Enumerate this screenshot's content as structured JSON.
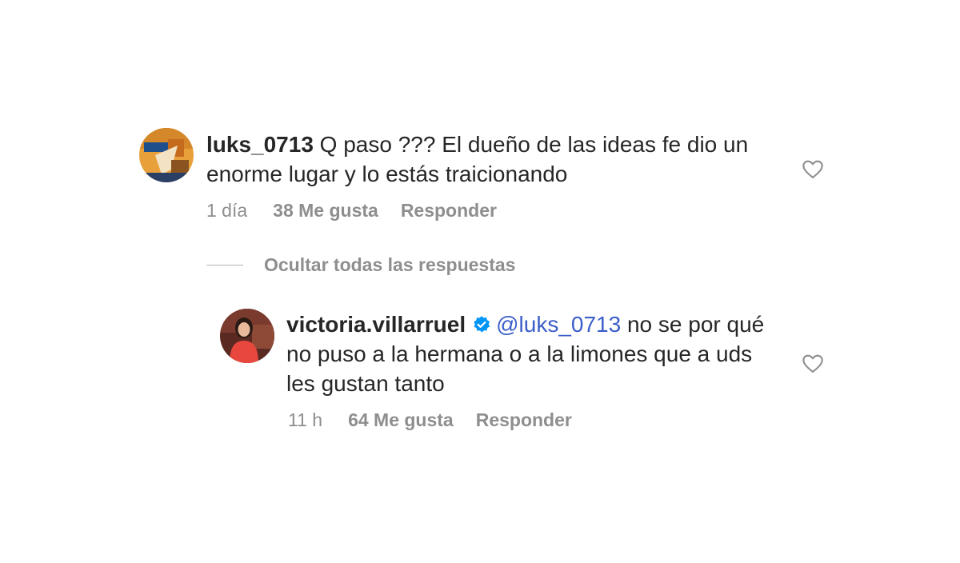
{
  "comments": [
    {
      "username": "luks_0713",
      "text": "Q paso ??? El dueño de las ideas fe dio un enorme lugar y lo estás traicionando",
      "time": "1 día",
      "likes": "38 Me gusta",
      "reply_label": "Responder"
    }
  ],
  "hide_replies_label": "Ocultar todas las respuestas",
  "replies": [
    {
      "username": "victoria.villarruel",
      "verified": true,
      "mention": "@luks_0713",
      "text": "no se por qué no puso a la hermana o a la limones que a uds les gustan tanto",
      "time": "11 h",
      "likes": "64 Me gusta",
      "reply_label": "Responder"
    }
  ],
  "colors": {
    "text": "#262626",
    "meta": "#8e8e8e",
    "mention": "#3b5ec9",
    "verified": "#0095f6"
  }
}
